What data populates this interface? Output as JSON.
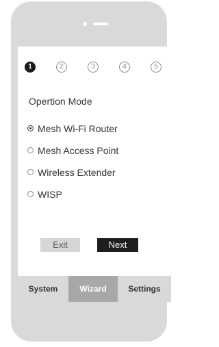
{
  "wizard": {
    "steps": [
      {
        "label": "1",
        "active": true
      },
      {
        "label": "2",
        "active": false
      },
      {
        "label": "3",
        "active": false
      },
      {
        "label": "4",
        "active": false
      },
      {
        "label": "5",
        "active": false
      }
    ]
  },
  "mode": {
    "title": "Opertion Mode",
    "selected": "Mesh Wi-Fi Router",
    "options": [
      {
        "label": "Mesh Wi-Fi Router",
        "checked": true
      },
      {
        "label": "Mesh Access Point",
        "checked": false
      },
      {
        "label": "Wireless Extender",
        "checked": false
      },
      {
        "label": "WISP",
        "checked": false
      }
    ]
  },
  "buttons": {
    "exit_label": "Exit",
    "next_label": "Next"
  },
  "tabs": {
    "active": "Wizard",
    "items": [
      {
        "label": "System"
      },
      {
        "label": "Wizard"
      },
      {
        "label": "Settings"
      }
    ]
  },
  "colors": {
    "phone_body": "#d9d9d9",
    "active_tab": "#a8a8a8",
    "primary_button": "#1e1e1e",
    "secondary_button": "#d6d6d6"
  }
}
